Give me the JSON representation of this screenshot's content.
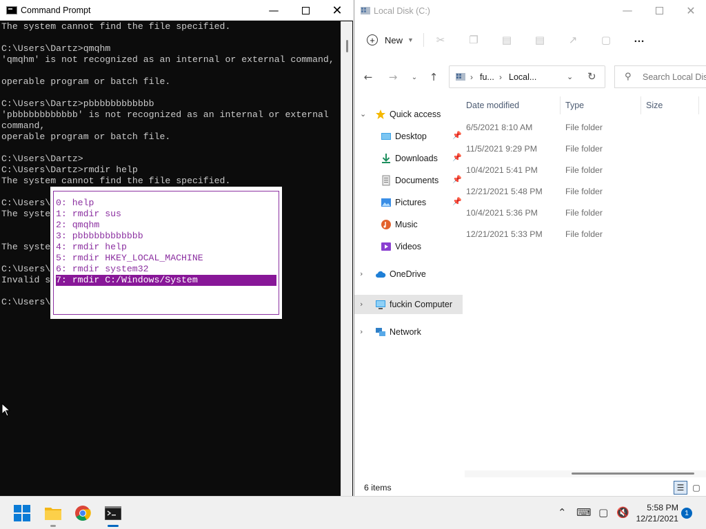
{
  "cmd": {
    "title": "Command Prompt",
    "icons": {
      "app": "cmd-icon",
      "minimize": "minimize-icon",
      "maximize": "maximize-icon",
      "close": "close-icon"
    },
    "console_lines": [
      "The system cannot find the file specified.",
      "",
      "C:\\Users\\Dartz>qmqhm",
      "'qmqhm' is not recognized as an internal or external command,",
      "",
      "operable program or batch file.",
      "",
      "C:\\Users\\Dartz>pbbbbbbbbbbbb",
      "'pbbbbbbbbbbbb' is not recognized as an internal or external",
      "command,",
      "operable program or batch file.",
      "",
      "C:\\Users\\Dartz>",
      "C:\\Users\\Dartz>rmdir help",
      "The system cannot find the file specified.",
      "",
      "C:\\Users\\",
      "The syste",
      "",
      "",
      "The syste",
      "",
      "C:\\Users\\",
      "Invalid s",
      "",
      "C:\\Users\\"
    ],
    "history": {
      "items": [
        "0: help",
        "1: rmdir sus",
        "2: qmqhm",
        "3: pbbbbbbbbbbbb",
        "4: rmdir help",
        "5: rmdir HKEY_LOCAL_MACHINE",
        "6: rmdir system32",
        "7: rmdir C:/Windows/System"
      ],
      "selected_index": 7,
      "color": "#881798"
    }
  },
  "explorer": {
    "title": "Local Disk (C:)",
    "toolbar": {
      "new_label": "New",
      "icons": [
        "cut-icon",
        "copy-icon",
        "paste-icon",
        "rename-icon",
        "share-icon",
        "delete-icon"
      ],
      "more_label": "…"
    },
    "address": {
      "crumbs": [
        "fu...",
        "Local..."
      ],
      "search_placeholder": "Search Local Disk"
    },
    "nav": [
      {
        "label": "Quick access",
        "icon": "star-icon",
        "expanded": true
      },
      {
        "label": "Desktop",
        "icon": "desktop-icon",
        "pinned": true
      },
      {
        "label": "Downloads",
        "icon": "download-icon",
        "pinned": true
      },
      {
        "label": "Documents",
        "icon": "document-icon",
        "pinned": true
      },
      {
        "label": "Pictures",
        "icon": "pictures-icon",
        "pinned": true
      },
      {
        "label": "Music",
        "icon": "music-icon"
      },
      {
        "label": "Videos",
        "icon": "video-icon"
      },
      {
        "label": "OneDrive",
        "icon": "cloud-icon"
      },
      {
        "label": "fuckin Computer",
        "icon": "computer-icon",
        "selected": true
      },
      {
        "label": "Network",
        "icon": "network-icon"
      }
    ],
    "columns": [
      "Date modified",
      "Type",
      "Size"
    ],
    "rows": [
      {
        "date": "6/5/2021 8:10 AM",
        "type": "File folder"
      },
      {
        "date": "11/5/2021 9:29 PM",
        "type": "File folder"
      },
      {
        "date": "10/4/2021 5:41 PM",
        "type": "File folder"
      },
      {
        "date": "12/21/2021 5:48 PM",
        "type": "File folder"
      },
      {
        "date": "10/4/2021 5:36 PM",
        "type": "File folder"
      },
      {
        "date": "12/21/2021 5:33 PM",
        "type": "File folder"
      }
    ],
    "status": {
      "item_count": "6 items"
    }
  },
  "taskbar": {
    "apps": [
      "windows-start-icon",
      "file-explorer-icon",
      "chrome-icon",
      "command-prompt-icon"
    ],
    "tray_icons": [
      "chevron-up-icon",
      "keyboard-icon",
      "display-icon",
      "volume-muted-icon"
    ],
    "time": "5:58 PM",
    "date": "12/21/2021",
    "notification_count": "1"
  },
  "colors": {
    "accent": "#0067c0",
    "console_bg": "#0c0c0c",
    "console_fg": "#cccccc",
    "history_purple": "#881798"
  }
}
